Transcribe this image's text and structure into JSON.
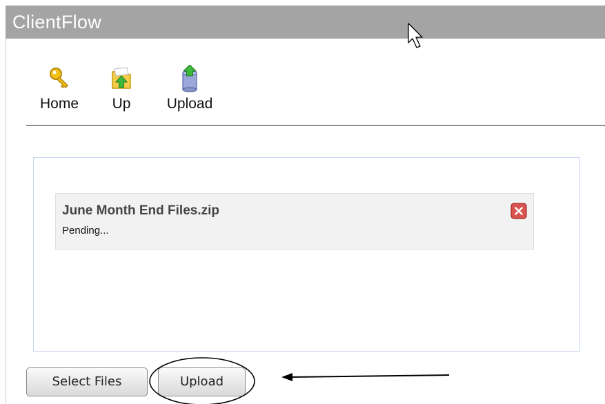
{
  "app": {
    "title": "ClientFlow"
  },
  "toolbar": {
    "items": [
      {
        "label": "Home",
        "icon": "key-icon"
      },
      {
        "label": "Up",
        "icon": "folder-up-icon"
      },
      {
        "label": "Upload",
        "icon": "database-upload-icon"
      }
    ]
  },
  "queue": {
    "files": [
      {
        "name": "June Month End Files.zip",
        "status": "Pending..."
      }
    ]
  },
  "actions": {
    "select_label": "Select Files",
    "upload_label": "Upload"
  },
  "colors": {
    "titlebar": "#a4a4a4",
    "remove_button": "#d9534f",
    "panel_border": "#c9d6f0"
  }
}
